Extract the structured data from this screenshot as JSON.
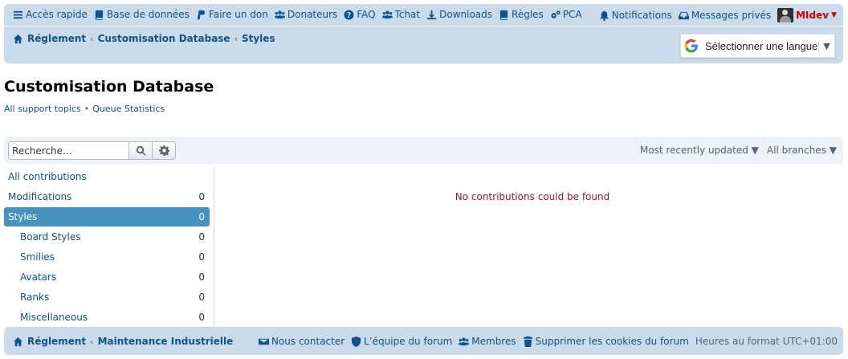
{
  "nav": {
    "left": [
      {
        "label": "Accès rapide",
        "icon": "menu-icon"
      },
      {
        "label": "Base de données",
        "icon": "book-icon"
      },
      {
        "label": "Faire un don",
        "icon": "paypal-icon"
      },
      {
        "label": "Donateurs",
        "icon": "users-icon"
      },
      {
        "label": "FAQ",
        "icon": "question-icon"
      },
      {
        "label": "Tchat",
        "icon": "users-icon"
      },
      {
        "label": "Downloads",
        "icon": "download-icon"
      },
      {
        "label": "Règles",
        "icon": "book-icon"
      },
      {
        "label": "PCA",
        "icon": "cogs-icon"
      }
    ],
    "notifications": "Notifications",
    "messages": "Messages privés",
    "username": "MIdev"
  },
  "breadcrumb": {
    "items": [
      "Réglement",
      "Customisation Database",
      "Styles"
    ]
  },
  "language": {
    "label": "Sélectionner une langue"
  },
  "page": {
    "title": "Customisation Database",
    "links": [
      "All support topics",
      "Queue Statistics"
    ]
  },
  "toolbar": {
    "search_placeholder": "Recherche…",
    "sort": "Most recently updated ▼",
    "branches": "All branches ▼"
  },
  "sidebar": {
    "items": [
      {
        "label": "All contributions",
        "count": ""
      },
      {
        "label": "Modifications",
        "count": "0"
      },
      {
        "label": "Styles",
        "count": "0"
      },
      {
        "label": "Board Styles",
        "count": "0"
      },
      {
        "label": "Smilies",
        "count": "0"
      },
      {
        "label": "Avatars",
        "count": "0"
      },
      {
        "label": "Ranks",
        "count": "0"
      },
      {
        "label": "Miscellaneous",
        "count": "0"
      }
    ]
  },
  "main": {
    "empty_message": "No contributions could be found"
  },
  "footer": {
    "crumbs": [
      "Réglement",
      "Maintenance Industrielle"
    ],
    "contact": "Nous contacter",
    "team": "L’équipe du forum",
    "members": "Membres",
    "cookies": "Supprimer les cookies du forum",
    "timezone": "Heures au format UTC+01:00"
  },
  "colors": {
    "header_bg": "#cadceb",
    "link": "#105289",
    "active": "#4692bf",
    "error": "#a5132a",
    "username": "#cc0000"
  }
}
